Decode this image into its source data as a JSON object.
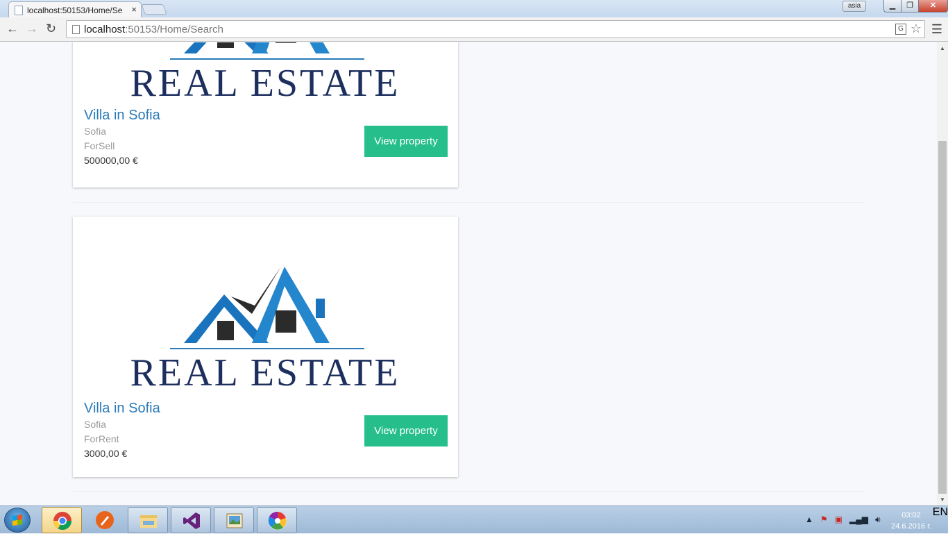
{
  "browser": {
    "tab_title": "localhost:50153/Home/Se",
    "tab_close": "×",
    "user_badge": "asia",
    "url_host": "localhost",
    "url_path": ":50153/Home/Search",
    "back": "←",
    "forward": "→",
    "reload": "↻",
    "menu": "☰",
    "star": "☆",
    "translate": "G"
  },
  "logo": {
    "text": "REAL ESTATE",
    "roof_color": "#1a73bd",
    "text_color": "#1d2f5e"
  },
  "listings": [
    {
      "title": "Villa in Sofia",
      "city": "Sofia",
      "status": "ForSell",
      "price": "500000,00 €",
      "button": "View property"
    },
    {
      "title": "Villa in Sofia",
      "city": "Sofia",
      "status": "ForRent",
      "price": "3000,00 €",
      "button": "View property"
    }
  ],
  "taskbar": {
    "lang": "EN",
    "time": "03:02",
    "date": "24.6.2016 г.",
    "apps": [
      "chrome-icon",
      "rocket-icon",
      "file-explorer-icon",
      "visual-studio-icon",
      "photo-viewer-icon",
      "picasa-icon"
    ]
  },
  "colors": {
    "accent_button": "#26bf8c",
    "title_link": "#2a7ab8"
  }
}
